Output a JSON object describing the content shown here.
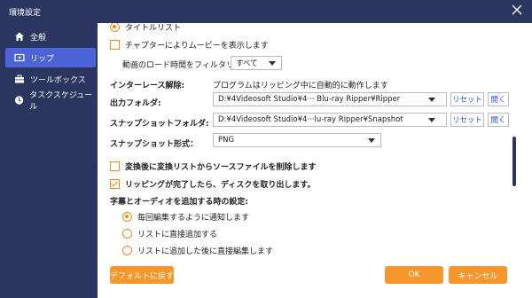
{
  "window": {
    "title": "環境設定"
  },
  "sidebar": {
    "items": [
      {
        "label": "全般",
        "icon": "home-icon"
      },
      {
        "label": "リップ",
        "icon": "video-icon"
      },
      {
        "label": "ツールボックス",
        "icon": "toolbox-icon"
      },
      {
        "label": "タスクスケジュール",
        "icon": "clock-icon"
      }
    ],
    "active_index": 1
  },
  "rip": {
    "top_radio_label": "タイトルリスト",
    "chapter_checkbox_label": "チャプターによりムービーを表示します",
    "filter_label": "動画のロード時間をフィルタリング:",
    "filter_value": "すべて",
    "interlace_label": "インターレース解除:",
    "interlace_value": "プログラムはリッピング中に自動的に動作します",
    "output_label": "出力フォルダ:",
    "output_path": "D:¥4Videosoft Studio¥4··· Blu-ray Ripper¥Ripper",
    "snapshot_label": "スナップショットフォルダ:",
    "snapshot_path": "D:¥4Videosoft Studio¥4···lu-ray Ripper¥Snapshot",
    "reset_label": "リセット",
    "open_label": "開く",
    "format_label": "スナップショット形式：",
    "format_value": "PNG",
    "delete_source_label": "変換後に変換リストからソースファイルを削除します",
    "eject_label": "リッピングが完了したら、ディスクを取り出します。",
    "subtitle_heading": "字幕とオーディオを追加する時の設定:",
    "subtitle_options": [
      "毎回編集するように通知します",
      "リストに直接追加する",
      "リストに追加した後に直接編集します"
    ],
    "subtitle_selected": 0
  },
  "footer": {
    "default_label": "デフォルトに戻す",
    "ok_label": "OK",
    "cancel_label": "キャンセル"
  },
  "colors": {
    "sidebar": "#2a3560",
    "accent": "#f7962b",
    "active": "#4d64d8"
  }
}
